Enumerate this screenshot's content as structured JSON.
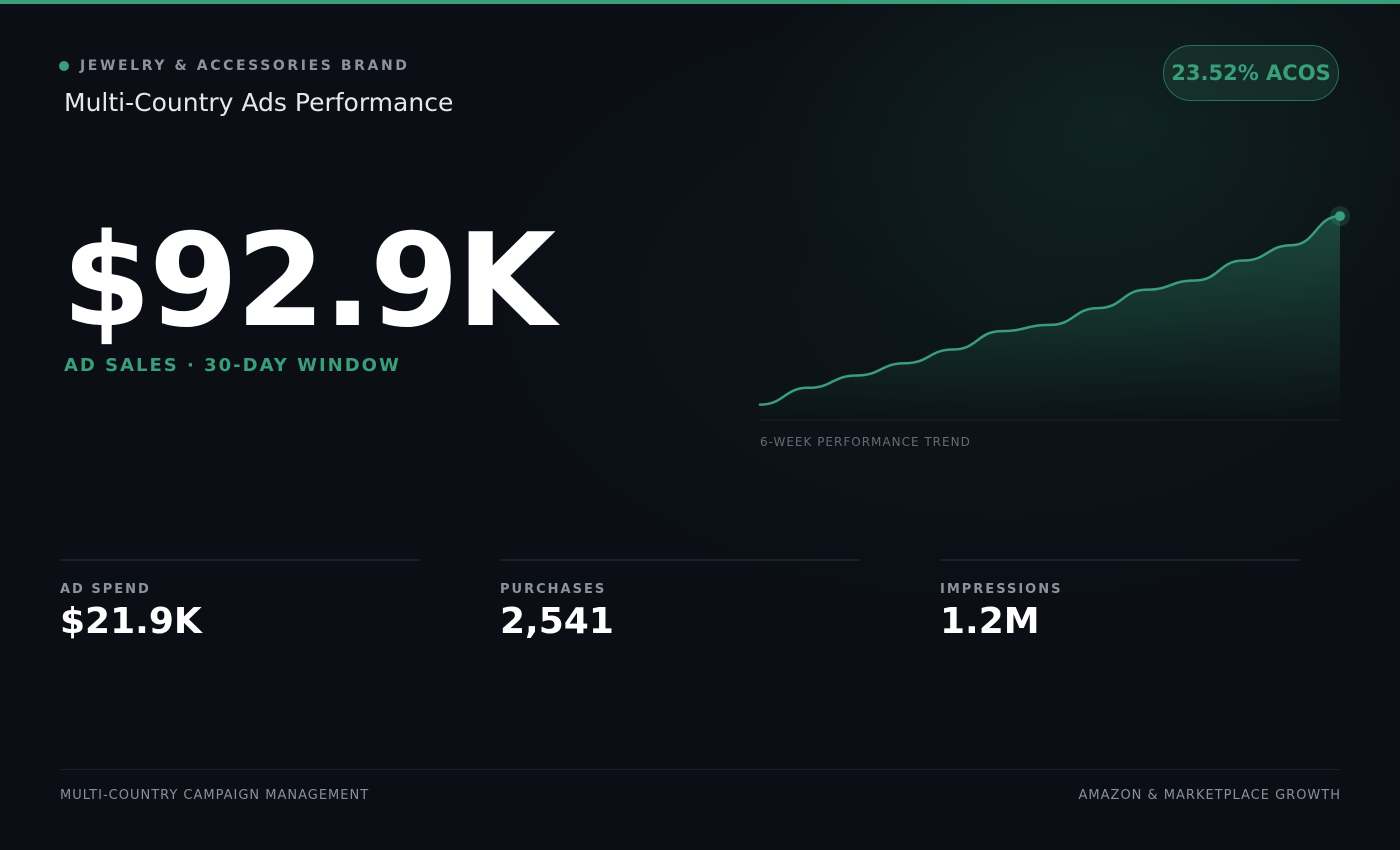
{
  "colors": {
    "accent": "#3a9e7a",
    "background": "#0b0f15"
  },
  "header": {
    "brand_label": "JEWELRY & ACCESSORIES BRAND",
    "title": "Multi-Country Ads Performance",
    "acos_badge": "23.52% ACOS"
  },
  "hero": {
    "value": "$92.9K",
    "caption": "AD SALES · 30-DAY WINDOW"
  },
  "trend": {
    "label": "6-WEEK PERFORMANCE TREND"
  },
  "chart_data": {
    "type": "area",
    "x": [
      0,
      1,
      2,
      3,
      4,
      5,
      6,
      7,
      8,
      9,
      10,
      11,
      12
    ],
    "values": [
      10,
      21,
      29,
      37,
      46,
      58,
      62,
      73,
      85,
      91,
      104,
      114,
      133
    ],
    "ylim": [
      0,
      150
    ],
    "grid": false,
    "legend": "none",
    "xlabel": "",
    "ylabel": ""
  },
  "metrics": [
    {
      "label": "AD SPEND",
      "value": "$21.9K"
    },
    {
      "label": "PURCHASES",
      "value": "2,541"
    },
    {
      "label": "IMPRESSIONS",
      "value": "1.2M"
    }
  ],
  "footer": {
    "left": "MULTI-COUNTRY CAMPAIGN MANAGEMENT",
    "right": "AMAZON & MARKETPLACE GROWTH"
  }
}
